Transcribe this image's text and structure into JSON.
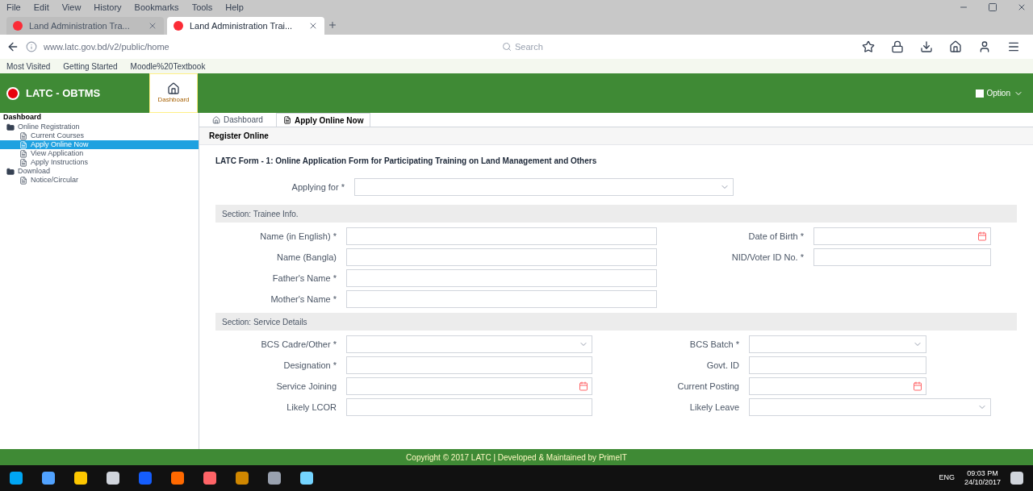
{
  "browser": {
    "menu": [
      "File",
      "Edit",
      "View",
      "History",
      "Bookmarks",
      "Tools",
      "Help"
    ],
    "tabs": [
      {
        "title": "Land Administration Tra...",
        "selected": false
      },
      {
        "title": "Land Administration Trai...",
        "selected": true
      }
    ],
    "address": "www.latc.gov.bd/v2/public/home",
    "search": {
      "placeholder": "Search"
    },
    "bookmarks": [
      "Most Visited",
      "Getting Started",
      "Moodle%20Textbook"
    ]
  },
  "app": {
    "brand": "LATC - OBTMS",
    "home_label": "Dashboard",
    "user_label": "Option"
  },
  "sidebar": {
    "title": "Dashboard",
    "tree": [
      {
        "label": "Online Registration",
        "selected": false,
        "children": [
          {
            "label": "Current Courses",
            "selected": false
          },
          {
            "label": "Apply Online Now",
            "selected": true
          },
          {
            "label": "View Application",
            "selected": false
          },
          {
            "label": "Apply Instructions",
            "selected": false
          }
        ]
      },
      {
        "label": "Download",
        "selected": false,
        "children": [
          {
            "label": "Notice/Circular",
            "selected": false
          }
        ]
      }
    ]
  },
  "content_tabs": [
    {
      "label": "Dashboard",
      "selected": false
    },
    {
      "label": "Apply Online Now",
      "selected": true
    }
  ],
  "panel_title": "Register Online",
  "form_title": "LATC Form - 1: Online Application Form for Participating Training on Land Management and Others",
  "applying_for": {
    "label": "Applying for *",
    "kind": "select"
  },
  "sections": [
    {
      "title": "Section: Trainee Info.",
      "left": [
        {
          "label": "Name (in English) *",
          "kind": "text"
        },
        {
          "label": "Name (Bangla)",
          "kind": "text"
        },
        {
          "label": "Father's Name *",
          "kind": "text"
        },
        {
          "label": "Mother's Name *",
          "kind": "text"
        }
      ],
      "right": [
        {
          "label": "Date of Birth *",
          "kind": "date"
        },
        {
          "label": "NID/Voter ID No. *",
          "kind": "text"
        }
      ]
    },
    {
      "title": "Section: Service Details",
      "left": [
        {
          "label": "BCS Cadre/Other *",
          "kind": "select"
        },
        {
          "label": "Designation *",
          "kind": "text"
        },
        {
          "label": "Service Joining",
          "kind": "date"
        },
        {
          "label": "Likely LCOR",
          "kind": "text"
        }
      ],
      "right": [
        {
          "label": "BCS Batch *",
          "kind": "select"
        },
        {
          "label": "Govt. ID",
          "kind": "text"
        },
        {
          "label": "Current Posting",
          "kind": "date"
        },
        {
          "label": "Likely Leave",
          "kind": "select"
        }
      ]
    }
  ],
  "footer": "Copyright © 2017 LATC | Developed & Maintained by PrimeIT",
  "taskbar": {
    "language": "ENG",
    "time": "09:03 PM",
    "date": "24/10/2017"
  }
}
